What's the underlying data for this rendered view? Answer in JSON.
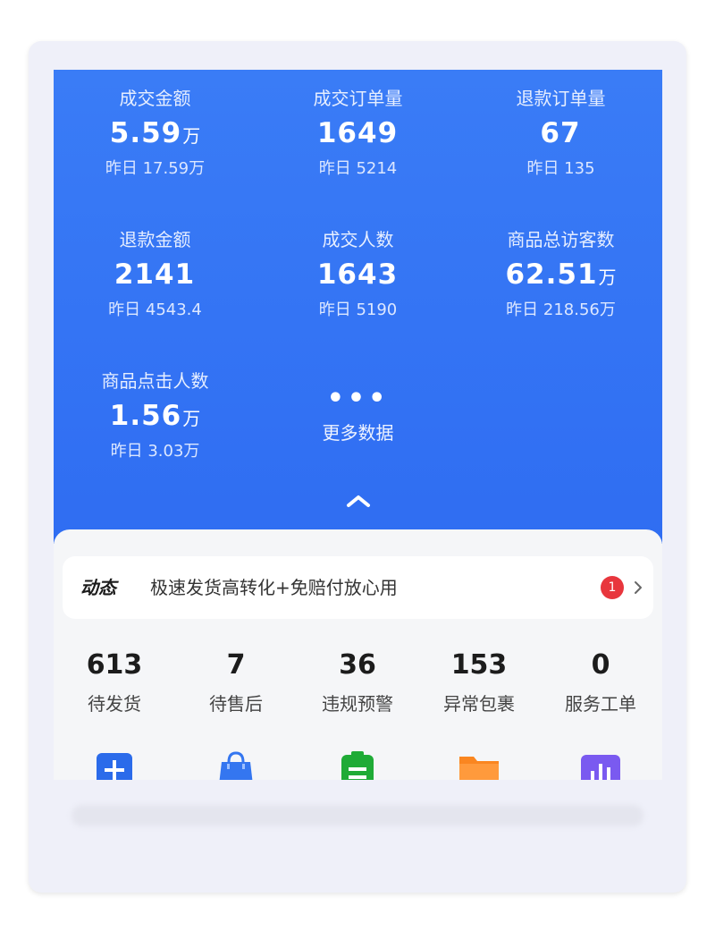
{
  "stats": [
    {
      "label": "成交金额",
      "value": "5.59",
      "unit": "万",
      "prev": "昨日 17.59万"
    },
    {
      "label": "成交订单量",
      "value": "1649",
      "unit": "",
      "prev": "昨日 5214"
    },
    {
      "label": "退款订单量",
      "value": "67",
      "unit": "",
      "prev": "昨日 135"
    },
    {
      "label": "退款金额",
      "value": "2141",
      "unit": "",
      "prev": "昨日 4543.4"
    },
    {
      "label": "成交人数",
      "value": "1643",
      "unit": "",
      "prev": "昨日 5190"
    },
    {
      "label": "商品总访客数",
      "value": "62.51",
      "unit": "万",
      "prev": "昨日 218.56万"
    },
    {
      "label": "商品点击人数",
      "value": "1.56",
      "unit": "万",
      "prev": "昨日 3.03万"
    }
  ],
  "more": {
    "dots": "•••",
    "label": "更多数据",
    "collapse_icon": "chevron-up-icon"
  },
  "notice": {
    "tag": "动态",
    "message": "极速发货高转化+免赔付放心用",
    "badge": "1",
    "arrow_icon": "chevron-right-icon"
  },
  "kpis": [
    {
      "value": "613",
      "label": "待发货"
    },
    {
      "value": "7",
      "label": "待售后"
    },
    {
      "value": "36",
      "label": "违规预警"
    },
    {
      "value": "153",
      "label": "异常包裹"
    },
    {
      "value": "0",
      "label": "服务工单"
    }
  ],
  "tools": [
    {
      "icon": "plus-icon",
      "color": "#2b6bea"
    },
    {
      "icon": "shopping-bag-icon",
      "color": "#3476f0"
    },
    {
      "icon": "clipboard-icon",
      "color": "#1fab36"
    },
    {
      "icon": "folder-icon",
      "color": "#fa8620"
    },
    {
      "icon": "bar-chart-icon",
      "color": "#7a5af0"
    }
  ],
  "colors": {
    "hero": "#3a7cf6",
    "badge": "#e8363d",
    "panel": "#f5f6f8"
  }
}
